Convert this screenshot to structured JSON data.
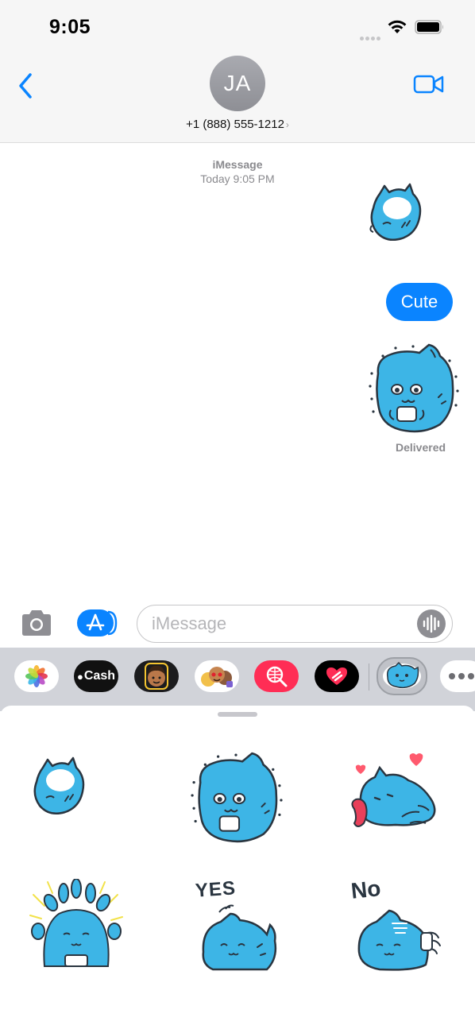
{
  "status": {
    "time": "9:05"
  },
  "header": {
    "avatar_initials": "JA",
    "contact": "+1 (888) 555-1212",
    "chevron": "›"
  },
  "conversation": {
    "service": "iMessage",
    "timestamp": "Today 9:05 PM",
    "message": "Cute",
    "delivery_status": "Delivered"
  },
  "input": {
    "placeholder": "iMessage"
  },
  "app_drawer": {
    "apps": [
      "photos-icon",
      "apple-cash-icon",
      "memoji-icon",
      "memoji-stickers-icon",
      "image-search-icon",
      "digital-touch-icon",
      "sticker-app-icon",
      "more-icon"
    ],
    "cash_label": "Cash"
  },
  "stickers": {
    "yes_label": "YES",
    "no_label": "No"
  },
  "colors": {
    "accent": "#0a84ff",
    "sticker_blue": "#3db5e6",
    "outline": "#2a3540"
  }
}
